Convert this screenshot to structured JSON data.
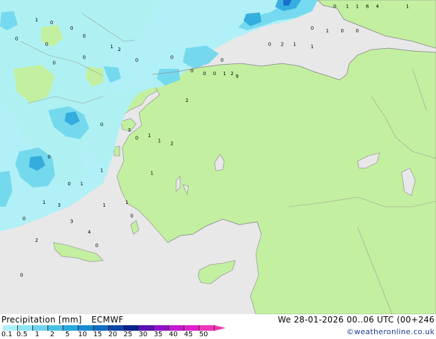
{
  "product": "Precipitation [mm]",
  "model": "ECMWF",
  "valid_time": "We 28-01-2026 00..06 UTC (00+246",
  "credit": "©weatheronline.co.uk",
  "legend": {
    "ticks": [
      "0.1",
      "0.5",
      "1",
      "2",
      "5",
      "10",
      "15",
      "20",
      "25",
      "30",
      "35",
      "40",
      "45",
      "50"
    ],
    "colors": [
      "#aef0f8",
      "#8ee4f2",
      "#6cd4ec",
      "#48c0e6",
      "#28a8dc",
      "#1a8ad0",
      "#126cc0",
      "#0c46a6",
      "#08228c",
      "#5a10b4",
      "#9010c8",
      "#c418d2",
      "#e020c8",
      "#f034b8"
    ]
  },
  "colors": {
    "sea": "#e8e8e8",
    "land": "#c3f0a0",
    "precip_light": "#aef0f8",
    "precip_mid": "#72d8ee",
    "precip_heavy": "#2ea8dc",
    "precip_max": "#1a6ed0"
  },
  "point_values": [
    {
      "v": "1",
      "lon": 21.4,
      "lat": 44.9
    },
    {
      "v": "0",
      "lon": 22.0,
      "lat": 44.8
    },
    {
      "v": "0",
      "lon": 22.8,
      "lat": 44.6
    },
    {
      "v": "0",
      "lon": 20.6,
      "lat": 44.2
    },
    {
      "v": "0",
      "lon": 21.8,
      "lat": 44.0
    },
    {
      "v": "0",
      "lon": 23.3,
      "lat": 44.3
    },
    {
      "v": "1",
      "lon": 24.4,
      "lat": 43.9
    },
    {
      "v": "2",
      "lon": 24.7,
      "lat": 43.8
    },
    {
      "v": "0",
      "lon": 22.1,
      "lat": 43.3
    },
    {
      "v": "0",
      "lon": 23.3,
      "lat": 43.5
    },
    {
      "v": "0",
      "lon": 25.4,
      "lat": 43.4
    },
    {
      "v": "0",
      "lon": 26.8,
      "lat": 43.5
    },
    {
      "v": "0",
      "lon": 27.6,
      "lat": 43.0
    },
    {
      "v": "0",
      "lon": 28.1,
      "lat": 42.9
    },
    {
      "v": "0",
      "lon": 28.5,
      "lat": 42.9
    },
    {
      "v": "1",
      "lon": 28.9,
      "lat": 42.9
    },
    {
      "v": "2",
      "lon": 29.2,
      "lat": 42.9
    },
    {
      "v": "9",
      "lon": 29.4,
      "lat": 42.8
    },
    {
      "v": "2",
      "lon": 27.4,
      "lat": 41.9
    },
    {
      "v": "0",
      "lon": 24.0,
      "lat": 41.0
    },
    {
      "v": "3",
      "lon": 25.1,
      "lat": 40.8
    },
    {
      "v": "0",
      "lon": 25.4,
      "lat": 40.5
    },
    {
      "v": "1",
      "lon": 26.3,
      "lat": 40.4
    },
    {
      "v": "2",
      "lon": 26.8,
      "lat": 40.3
    },
    {
      "v": "0",
      "lon": 21.9,
      "lat": 39.8
    },
    {
      "v": "1",
      "lon": 24.0,
      "lat": 39.3
    },
    {
      "v": "1",
      "lon": 26.0,
      "lat": 39.2
    },
    {
      "v": "0",
      "lon": 22.7,
      "lat": 38.8
    },
    {
      "v": "3",
      "lon": 22.3,
      "lat": 38.0
    },
    {
      "v": "1",
      "lon": 24.1,
      "lat": 38.0
    },
    {
      "v": "0",
      "lon": 20.9,
      "lat": 37.5
    },
    {
      "v": "3",
      "lon": 22.8,
      "lat": 37.4
    },
    {
      "v": "4",
      "lon": 23.5,
      "lat": 37.0
    },
    {
      "v": "0",
      "lon": 25.2,
      "lat": 37.6
    },
    {
      "v": "2",
      "lon": 21.4,
      "lat": 36.7
    },
    {
      "v": "0",
      "lon": 20.8,
      "lat": 35.4
    },
    {
      "v": "0",
      "lon": 33.3,
      "lat": 45.4
    },
    {
      "v": "1",
      "lon": 33.8,
      "lat": 45.4
    },
    {
      "v": "1",
      "lon": 34.2,
      "lat": 45.4
    },
    {
      "v": "6",
      "lon": 34.6,
      "lat": 45.4
    },
    {
      "v": "4",
      "lon": 35.0,
      "lat": 45.4
    },
    {
      "v": "1",
      "lon": 36.2,
      "lat": 45.4
    },
    {
      "v": "0",
      "lon": 32.4,
      "lat": 44.6
    },
    {
      "v": "1",
      "lon": 33.0,
      "lat": 44.5
    },
    {
      "v": "0",
      "lon": 33.6,
      "lat": 44.5
    },
    {
      "v": "0",
      "lon": 34.2,
      "lat": 44.5
    },
    {
      "v": "0",
      "lon": 30.7,
      "lat": 44.0
    },
    {
      "v": "2",
      "lon": 31.2,
      "lat": 44.0
    },
    {
      "v": "1",
      "lon": 31.7,
      "lat": 44.0
    },
    {
      "v": "1",
      "lon": 32.4,
      "lat": 43.9
    },
    {
      "v": "0",
      "lon": 28.8,
      "lat": 43.4
    },
    {
      "v": "1",
      "lon": 25.9,
      "lat": 40.6
    },
    {
      "v": "1",
      "lon": 23.2,
      "lat": 38.8
    },
    {
      "v": "1",
      "lon": 21.7,
      "lat": 38.1
    },
    {
      "v": "1",
      "lon": 25.0,
      "lat": 38.1
    },
    {
      "v": "0",
      "lon": 23.8,
      "lat": 36.5
    }
  ]
}
